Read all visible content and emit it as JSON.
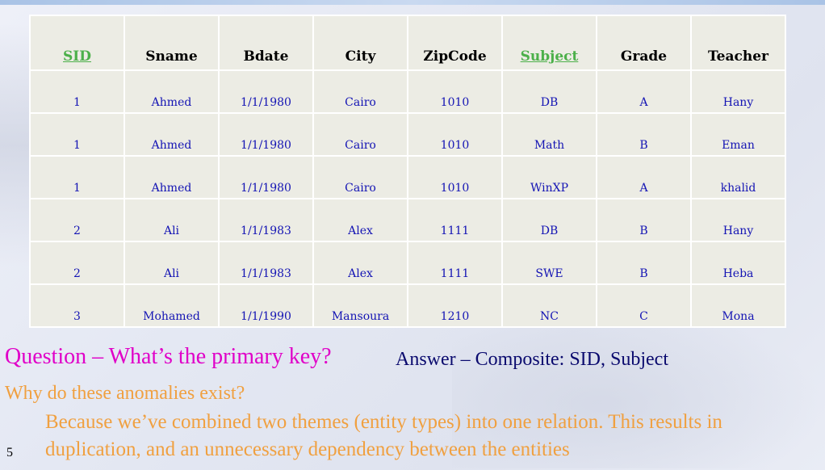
{
  "table": {
    "headers": [
      {
        "label": "SID",
        "key": true
      },
      {
        "label": "Sname",
        "key": false
      },
      {
        "label": "Bdate",
        "key": false
      },
      {
        "label": "City",
        "key": false
      },
      {
        "label": "ZipCode",
        "key": false
      },
      {
        "label": "Subject",
        "key": true
      },
      {
        "label": "Grade",
        "key": false
      },
      {
        "label": "Teacher",
        "key": false
      }
    ],
    "rows": [
      [
        "1",
        "Ahmed",
        "1/1/1980",
        "Cairo",
        "1010",
        "DB",
        "A",
        "Hany"
      ],
      [
        "1",
        "Ahmed",
        "1/1/1980",
        "Cairo",
        "1010",
        "Math",
        "B",
        "Eman"
      ],
      [
        "1",
        "Ahmed",
        "1/1/1980",
        "Cairo",
        "1010",
        "WinXP",
        "A",
        "khalid"
      ],
      [
        "2",
        "Ali",
        "1/1/1983",
        "Alex",
        "1111",
        "DB",
        "B",
        "Hany"
      ],
      [
        "2",
        "Ali",
        "1/1/1983",
        "Alex",
        "1111",
        "SWE",
        "B",
        "Heba"
      ],
      [
        "3",
        "Mohamed",
        "1/1/1990",
        "Mansoura",
        "1210",
        "NC",
        "C",
        "Mona"
      ]
    ]
  },
  "question": "Question – What’s the primary key?",
  "answer": "Answer – Composite: SID, Subject",
  "why": "Why do these anomalies exist?",
  "because": "Because we’ve combined two themes (entity types) into one relation. This results in duplication, and an unnecessary dependency between the entities",
  "slide_number": "5",
  "colors": {
    "key_header": "#4cb04a",
    "cell_text": "#1414b4",
    "question": "#e000c8",
    "answer": "#0a0a6e",
    "body_orange": "#f0a040"
  }
}
